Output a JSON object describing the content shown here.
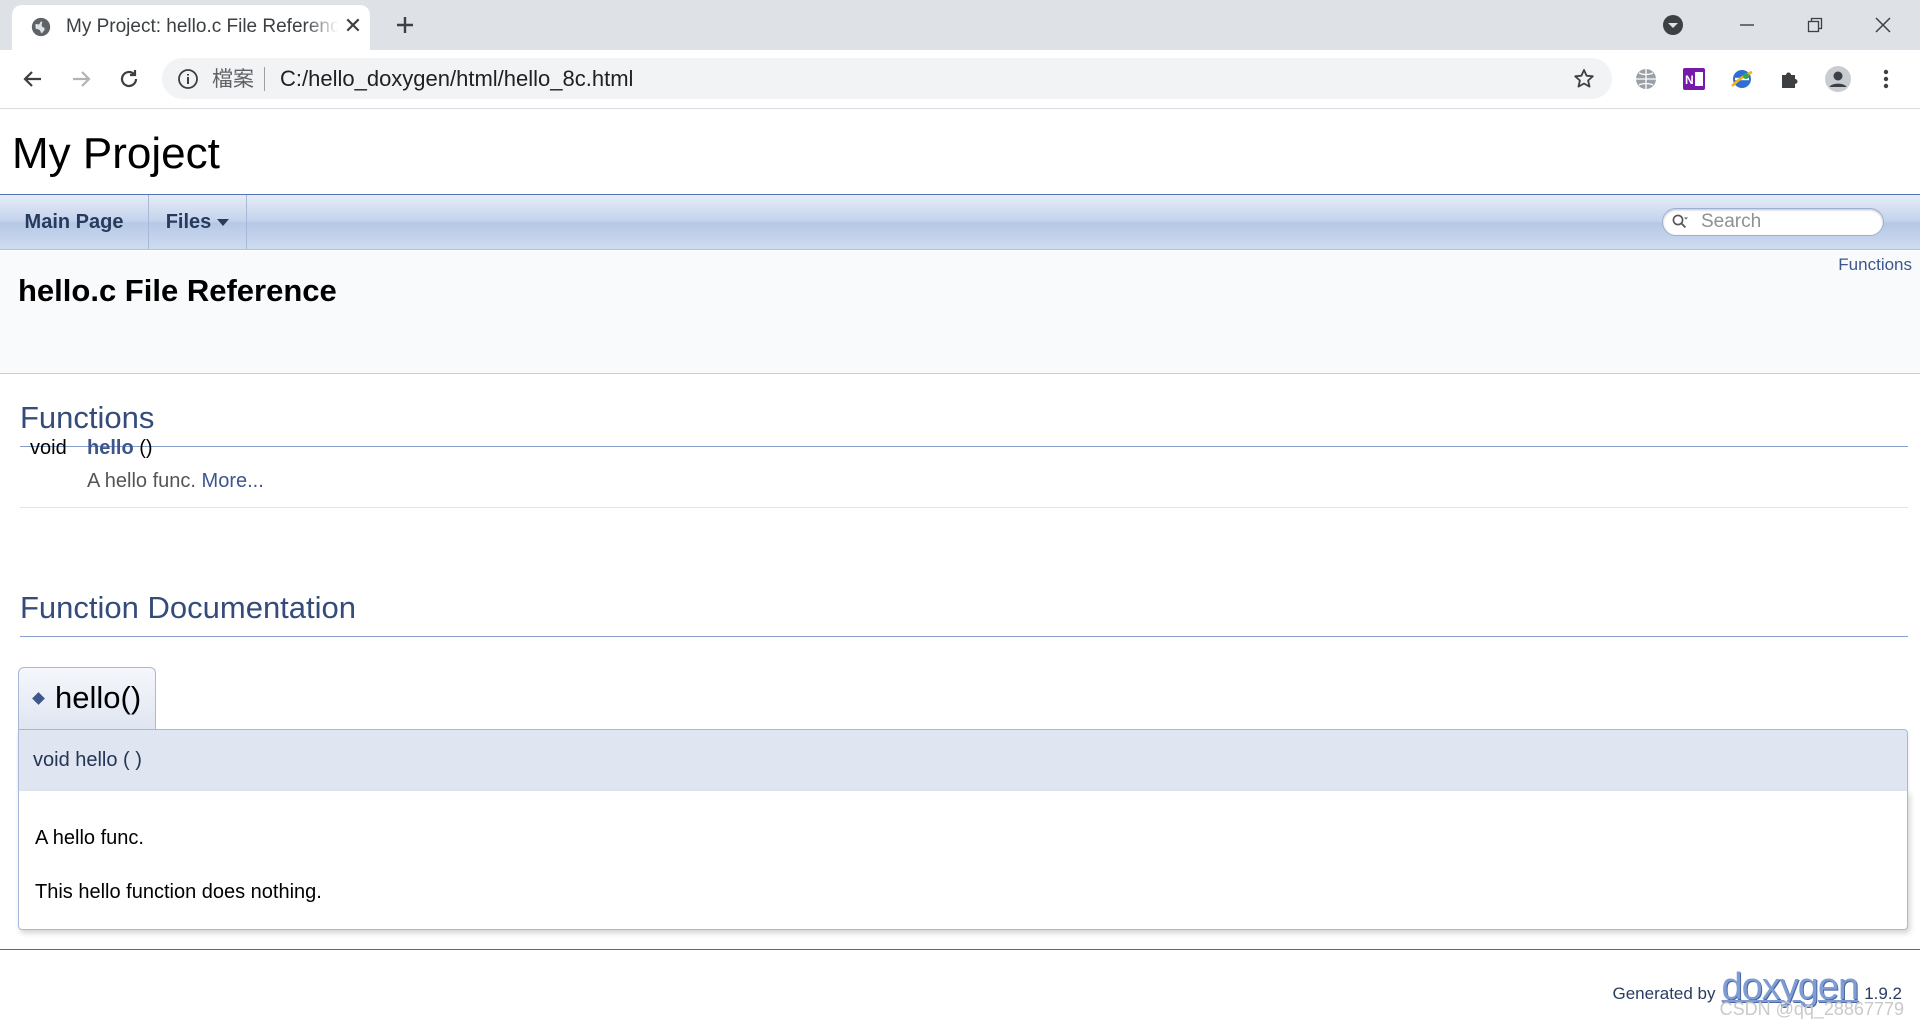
{
  "browser": {
    "tab": {
      "title": "My Project: hello.c File Reference",
      "close_glyph": "✕"
    },
    "address": {
      "security_label": "檔案",
      "url": "C:/hello_doxygen/html/hello_8c.html"
    },
    "extensions": [
      "globe-extension-icon",
      "onenote-icon",
      "ie-tab-icon",
      "puzzle-extensions-icon",
      "profile-icon",
      "menu-kebab-icon"
    ]
  },
  "page": {
    "project_title": "My Project",
    "nav": {
      "main_page": "Main Page",
      "files": "Files",
      "search_placeholder": "Search"
    },
    "summary_link": "Functions",
    "file_title": "hello.c File Reference",
    "functions_header": "Functions",
    "member": {
      "type": "void",
      "name": "hello",
      "args": " ()",
      "brief": "A hello func. ",
      "more": "More..."
    },
    "func_doc_header": "Function Documentation",
    "memdoc": {
      "title": "hello()",
      "prototype": "void hello (  )",
      "brief": "A hello func.",
      "detail": "This hello function does nothing."
    },
    "footer": {
      "generated_by": "Generated by",
      "logo": "doxygen",
      "version": "1.9.2"
    },
    "watermark": "CSDN @qq_28867779"
  },
  "colors": {
    "link": "#3d578c",
    "header_blue": "#354c7b",
    "chrome_bg": "#dee1e6"
  }
}
